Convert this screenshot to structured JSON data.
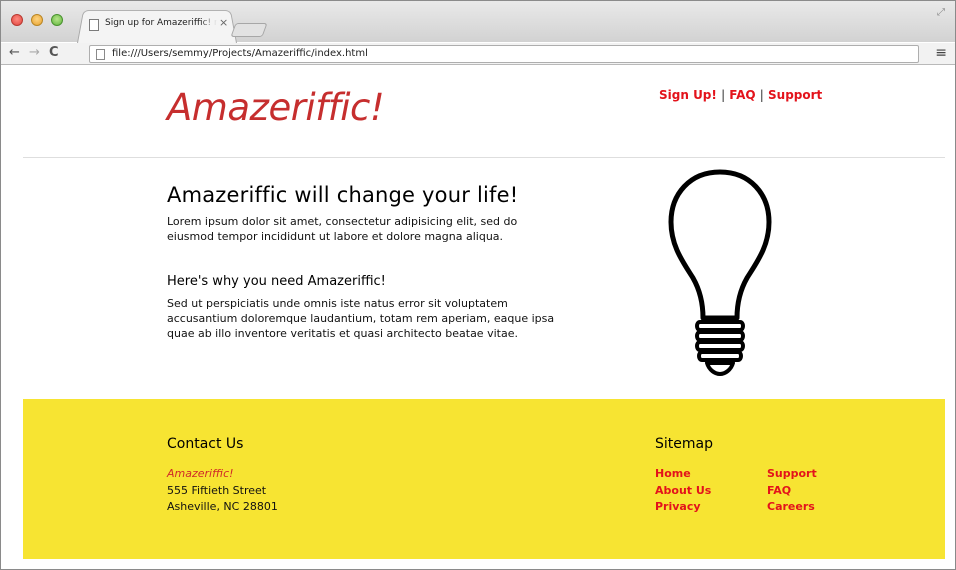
{
  "browser": {
    "tab_title": "Sign up for Amazeriffic! no",
    "tab_close": "×",
    "url": "file:///Users/semmy/Projects/Amazeriffic/index.html",
    "back": "←",
    "forward": "→",
    "reload": "C",
    "menu": "≡",
    "resize": "⤢"
  },
  "header": {
    "logo": "Amazeriffic!",
    "nav": [
      {
        "label": "Sign Up!"
      },
      {
        "label": "FAQ"
      },
      {
        "label": "Support"
      }
    ],
    "separator": "|"
  },
  "main": {
    "headline": "Amazeriffic will change your life!",
    "intro": "Lorem ipsum dolor sit amet, consectetur adipisicing elit, sed do eiusmod tempor incididunt ut labore et dolore magna aliqua.",
    "subheadline": "Here's why you need Amazeriffic!",
    "body": "Sed ut perspiciatis unde omnis iste natus error sit voluptatem accusantium doloremque laudantium, totam rem aperiam, eaque ipsa quae ab illo inventore veritatis et quasi architecto beatae vitae.",
    "image_icon": "lightbulb-icon"
  },
  "footer": {
    "contact_heading": "Contact Us",
    "brand": "Amazeriffic!",
    "address_line1": "555 Fiftieth Street",
    "address_line2": "Asheville, NC 28801",
    "sitemap_heading": "Sitemap",
    "links_col1": [
      "Home",
      "About Us",
      "Privacy"
    ],
    "links_col2": [
      "Support",
      "FAQ",
      "Careers"
    ]
  },
  "colors": {
    "brand_red": "#c62e2e",
    "link_red": "#e3131b",
    "footer_yellow": "#f7e432"
  }
}
